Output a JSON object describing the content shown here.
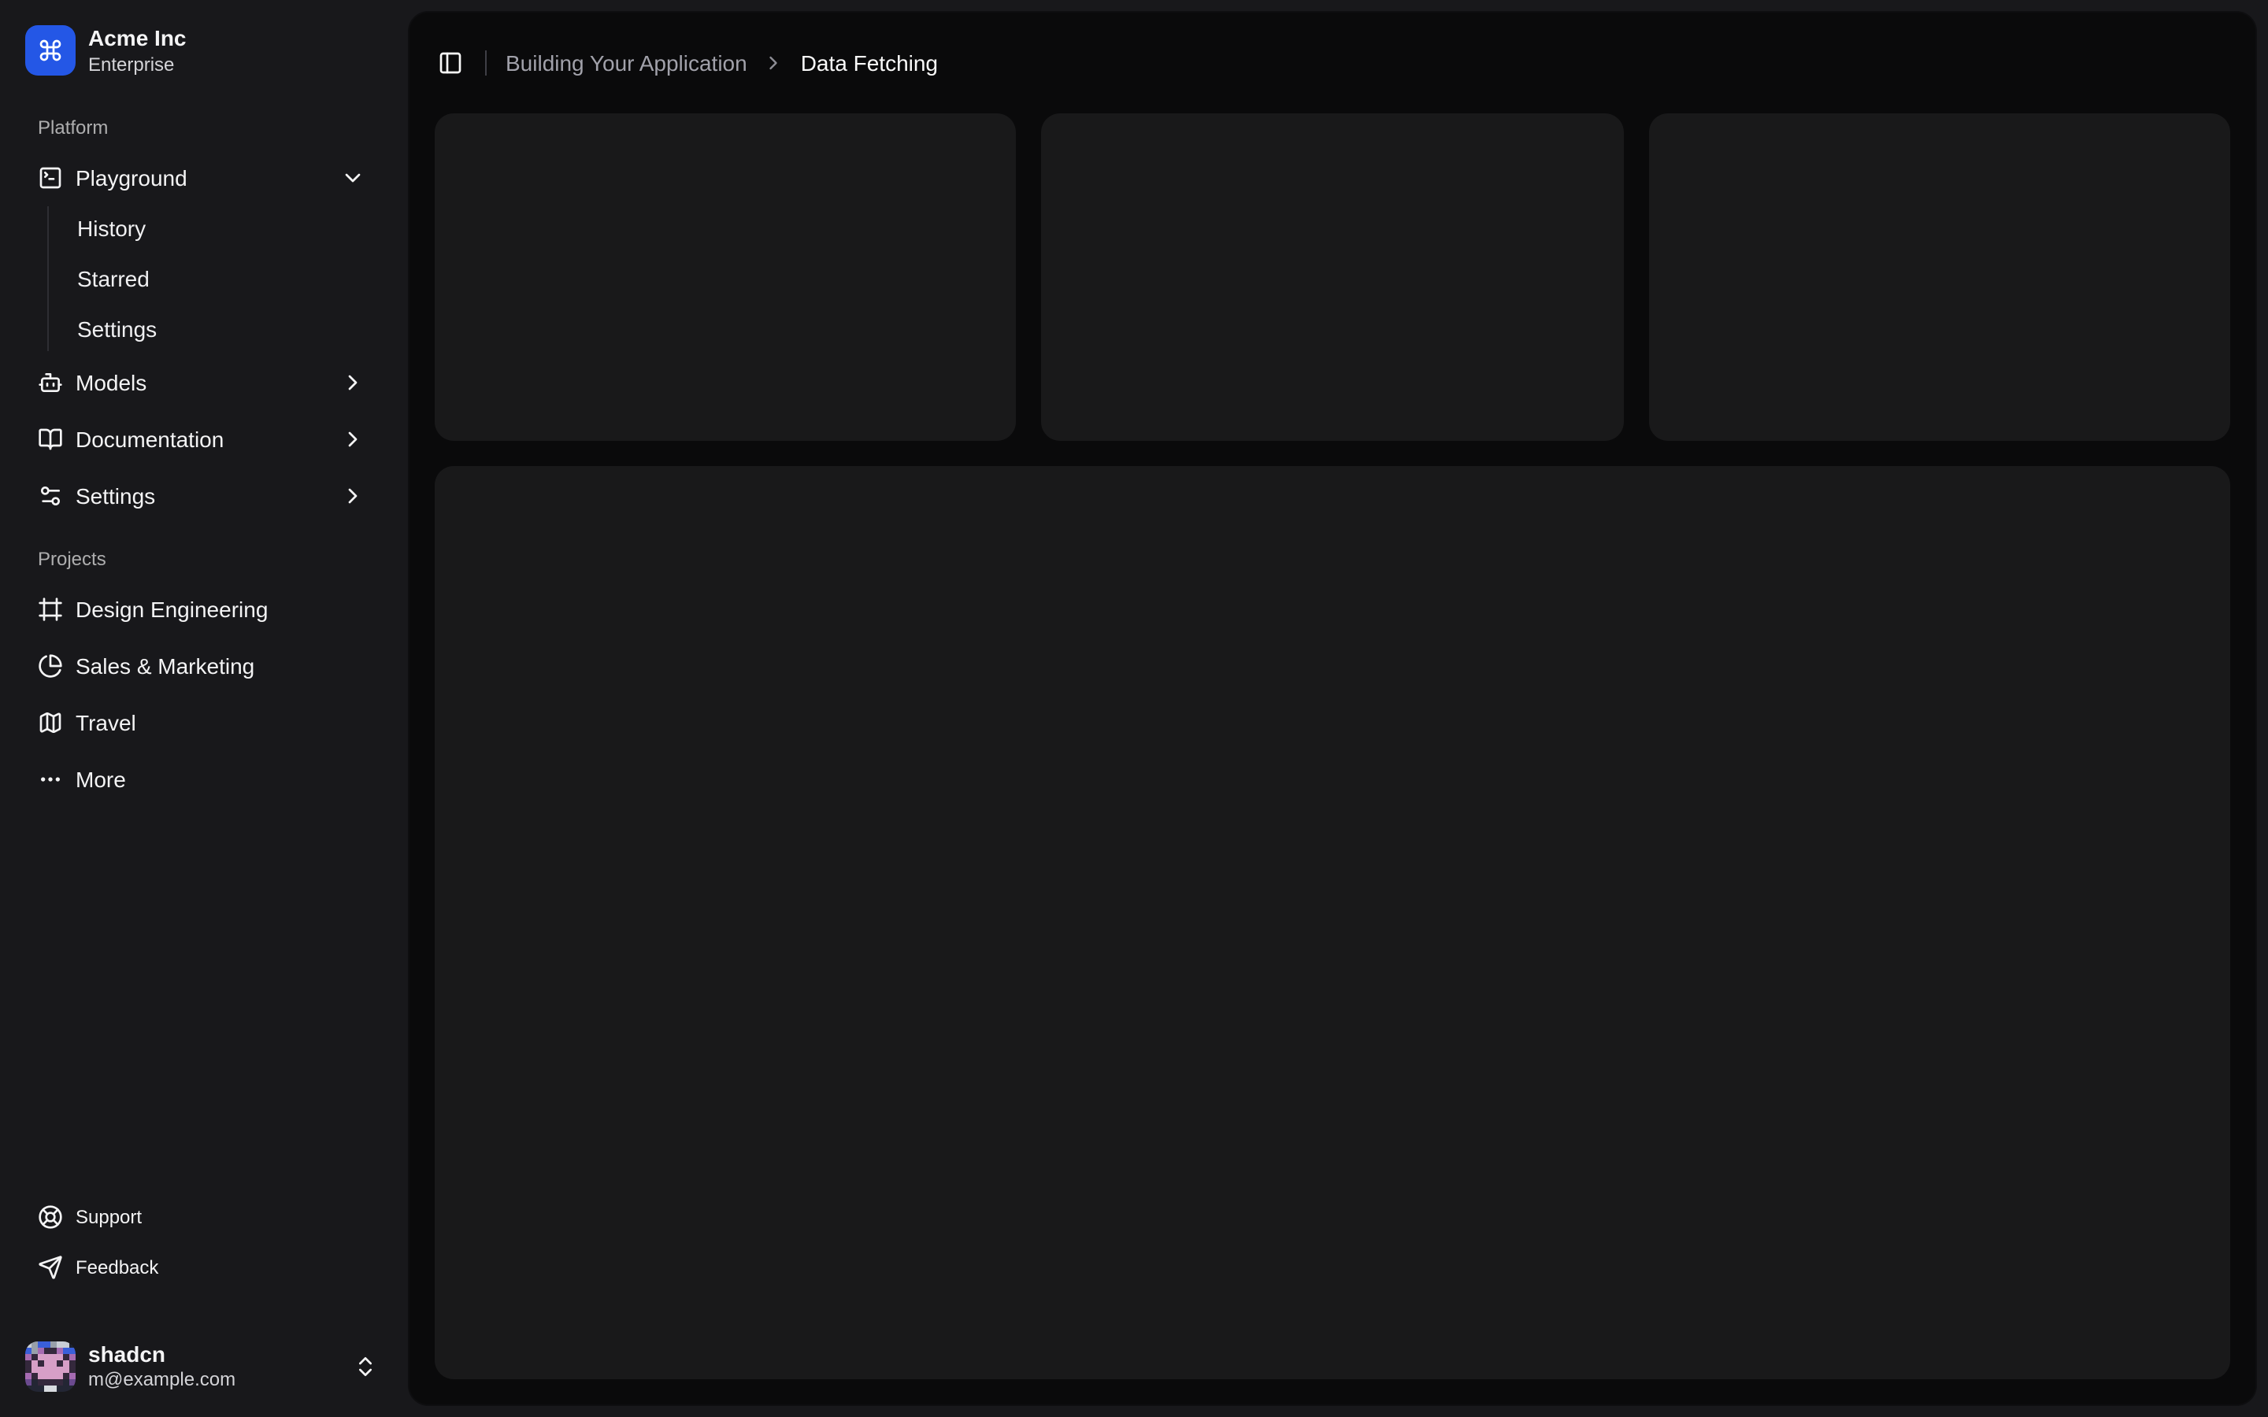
{
  "colors": {
    "accent": "#2457e6",
    "sidebar_bg": "#18181b",
    "main_bg": "#0a0a0b"
  },
  "sidebar": {
    "team": {
      "name": "Acme Inc",
      "plan": "Enterprise",
      "logo_icon": "command-icon"
    },
    "groups": [
      {
        "label": "Platform",
        "items": [
          {
            "label": "Playground",
            "icon": "square-terminal-icon",
            "state": "expanded",
            "children": [
              {
                "label": "History"
              },
              {
                "label": "Starred"
              },
              {
                "label": "Settings"
              }
            ]
          },
          {
            "label": "Models",
            "icon": "bot-icon",
            "state": "collapsed"
          },
          {
            "label": "Documentation",
            "icon": "book-open-icon",
            "state": "collapsed"
          },
          {
            "label": "Settings",
            "icon": "sliders-icon",
            "state": "collapsed"
          }
        ]
      },
      {
        "label": "Projects",
        "items": [
          {
            "label": "Design Engineering",
            "icon": "frame-icon"
          },
          {
            "label": "Sales & Marketing",
            "icon": "pie-chart-icon"
          },
          {
            "label": "Travel",
            "icon": "map-icon"
          },
          {
            "label": "More",
            "icon": "ellipsis-icon"
          }
        ]
      }
    ],
    "secondary": [
      {
        "label": "Support",
        "icon": "life-buoy-icon"
      },
      {
        "label": "Feedback",
        "icon": "send-icon"
      }
    ],
    "user": {
      "name": "shadcn",
      "email": "m@example.com"
    }
  },
  "header": {
    "breadcrumb": {
      "parent": "Building Your Application",
      "current": "Data Fetching"
    }
  }
}
